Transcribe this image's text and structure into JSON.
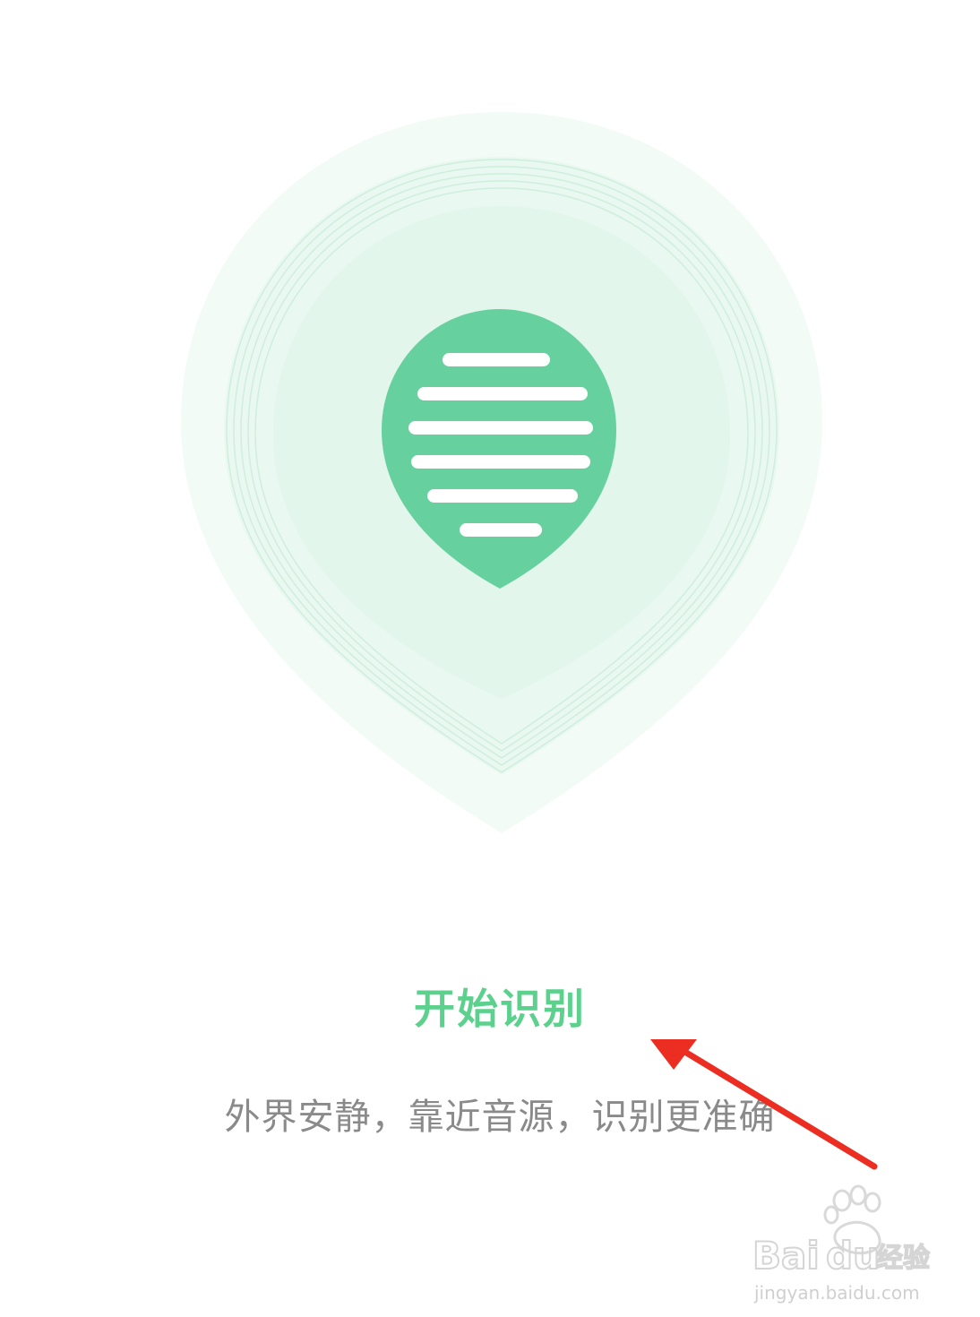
{
  "colors": {
    "accent": "#66d19e",
    "accent_text": "#5cd18d",
    "halo_outer": "#f3fbf7",
    "halo_mid": "#e9f8f0",
    "halo_inner": "#e2f6ec",
    "ring": "#cfeedd",
    "hint_text": "#8a8a8a",
    "annotation_arrow": "#ec2d22",
    "background": "#ffffff"
  },
  "recognize": {
    "icon": "sound-wave-drop-icon",
    "start_label": "开始识别",
    "hint": "外界安静，靠近音源，识别更准确"
  },
  "watermark": {
    "logo": "Bai du 经验",
    "url": "jingyan.baidu.com"
  }
}
